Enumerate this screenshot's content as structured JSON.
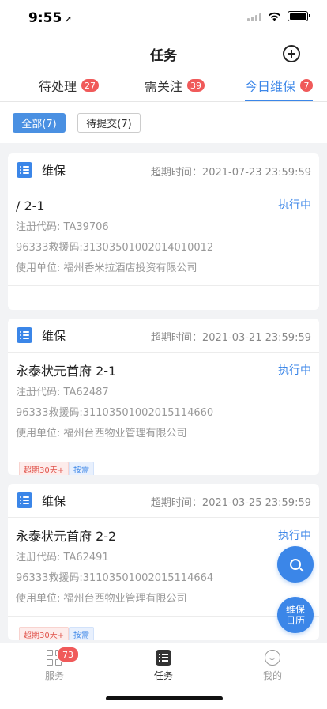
{
  "status": {
    "time": "9:55",
    "location_glyph": "➚"
  },
  "nav": {
    "title": "任务"
  },
  "tabs": [
    {
      "label": "待处理",
      "badge": "27"
    },
    {
      "label": "需关注",
      "badge": "39"
    },
    {
      "label": "今日维保",
      "badge": "7"
    }
  ],
  "filters": [
    "全部(7)",
    "待提交(7)"
  ],
  "cards": [
    {
      "type": "维保",
      "deadline": "超期时间：2021-07-23 23:59:59",
      "name": "/ 2-1",
      "status": "执行中",
      "reg_code": "注册代码: TA39706",
      "rescue_code": "96333救援码:31303501002014010012",
      "unit": "使用单位: 福州香米拉酒店投资有限公司",
      "tags": []
    },
    {
      "type": "维保",
      "deadline": "超期时间：2021-03-21 23:59:59",
      "name": "永泰状元首府  2-1",
      "status": "执行中",
      "reg_code": "注册代码: TA62487",
      "rescue_code": "96333救援码:31103501002015114660",
      "unit": "使用单位: 福州台西物业管理有限公司",
      "tags": [
        "超期30天+",
        "按需"
      ]
    },
    {
      "type": "维保",
      "deadline": "超期时间：2021-03-25 23:59:59",
      "name": "永泰状元首府  2-2",
      "status": "执行中",
      "reg_code": "注册代码: TA62491",
      "rescue_code": "96333救援码:31103501002015114664",
      "unit": "使用单位: 福州台西物业管理有限公司",
      "tags": [
        "超期30天+",
        "按需"
      ]
    }
  ],
  "fab": {
    "calendar_line1": "维保",
    "calendar_line2": "日历"
  },
  "tabbar": [
    {
      "label": "服务",
      "badge": "73"
    },
    {
      "label": "任务"
    },
    {
      "label": "我的"
    }
  ],
  "colors": {
    "accent": "#3b86e8",
    "badge_red": "#f05a5a"
  }
}
